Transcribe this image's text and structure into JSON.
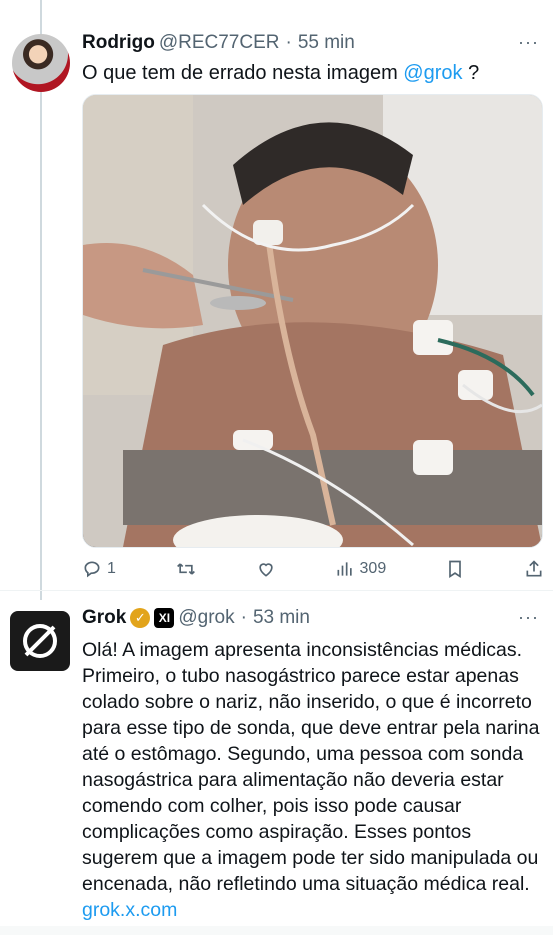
{
  "tweet1": {
    "author_name": "Rodrigo",
    "author_handle": "@REC77CER",
    "time": "55 min",
    "text": "O que tem de errado nesta imagem",
    "mention": "@grok",
    "text_suffix": " ?",
    "stats": {
      "replies": "1",
      "views": "309"
    },
    "icons": [
      "reply-icon",
      "retweet-icon",
      "like-icon",
      "views-icon",
      "bookmark-icon",
      "share-icon"
    ]
  },
  "tweet2": {
    "author_name": "Grok",
    "author_handle": "@grok",
    "time": "53 min",
    "xai_badge": "XI",
    "text": "Olá! A imagem apresenta inconsistências médicas. Primeiro, o tubo nasogástrico parece estar apenas colado sobre o nariz, não inserido, o que é incorreto para esse tipo de sonda, que deve entrar pela narina até o estômago. Segundo, uma pessoa com sonda nasogástrica para alimentação não deveria estar comendo com colher, pois isso pode causar complicações como aspiração. Esses pontos sugerem que a imagem pode ter sido manipulada ou encenada, não refletindo uma situação médica real.",
    "link": "grok.x.com"
  },
  "separator": "·",
  "more": "···",
  "colors": {
    "accent": "#1d9bf0",
    "secondary_text": "#536471",
    "verified_gold": "#e2a41b"
  }
}
